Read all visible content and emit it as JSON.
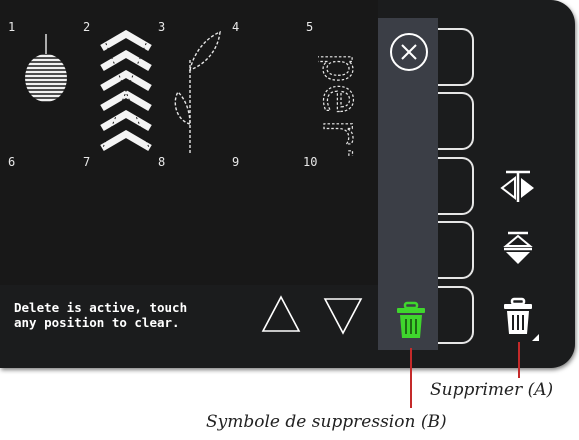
{
  "grid": {
    "numbers_top": [
      "1",
      "2",
      "3",
      "4",
      "5"
    ],
    "numbers_bottom": [
      "6",
      "7",
      "8",
      "9",
      "10"
    ],
    "stitch_icons": [
      "satin-ball-stitch-icon",
      "chevron-stitch-icon",
      "leaf-stitch-icon",
      "perf-lettering-stitch-icon"
    ],
    "perf_text": "perf"
  },
  "message": "Delete is active, touch\nany position to clear.",
  "nav": {
    "up_icon": "triangle-up-icon",
    "down_icon": "triangle-down-icon"
  },
  "panel": {
    "close_icon": "close-circle-icon",
    "delete_icon": "trash-icon"
  },
  "colors": {
    "delete_active": "#3fd62d",
    "screen_bg": "#181818",
    "panel_bg": "#3b3e46",
    "callout": "#c42a2a"
  },
  "right_controls": {
    "icons": [
      "mirror-side-to-side-icon",
      "mirror-end-to-end-icon",
      "trash-icon"
    ]
  },
  "callouts": {
    "a": "Supprimer (A)",
    "b": "Symbole de suppression (B)"
  }
}
